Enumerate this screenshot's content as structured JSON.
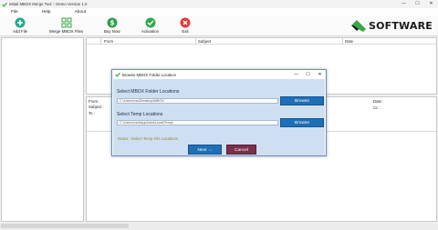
{
  "window": {
    "title": "eMail MBOX Merge Tool :: Demo Version 1.0",
    "minimize": "—",
    "maximize": "☐",
    "close": "✕"
  },
  "menu": [
    "File",
    "Help",
    "About"
  ],
  "toolbar": {
    "add_file": "Add File",
    "merge_mbox": "Merge MBOX Files",
    "buy_now": "Buy Now",
    "activation": "Activation",
    "exit": "Exit"
  },
  "brand": {
    "name": "SOFTWARE"
  },
  "message_list": {
    "columns": [
      "From",
      "Subject",
      "Date"
    ]
  },
  "preview": {
    "from": "From :",
    "subject": "Subject :",
    "to": "To :",
    "date": "Date :",
    "cc": "Cc :"
  },
  "dialog": {
    "title": "Browse MBOX Folder Location",
    "minimize": "—",
    "maximize": "☐",
    "close": "✕",
    "mbox_label": "Select MBOX Folder Locations",
    "mbox_path": "C:\\Users\\vsd\\Desktop\\MBOX",
    "temp_label": "Select Temp Locations",
    "temp_path": "C:\\Users\\vsd\\AppData\\Local\\Temp\\",
    "browse": "Browse",
    "note": "Notes : Select Temp File Locations",
    "next": "Next  →",
    "cancel": "Cancel"
  },
  "colors": {
    "dialog_body": "#cfdff2",
    "primary_button": "#1f6fb7",
    "cancel_button": "#7a2f4a",
    "brand_green": "#3aa845"
  }
}
